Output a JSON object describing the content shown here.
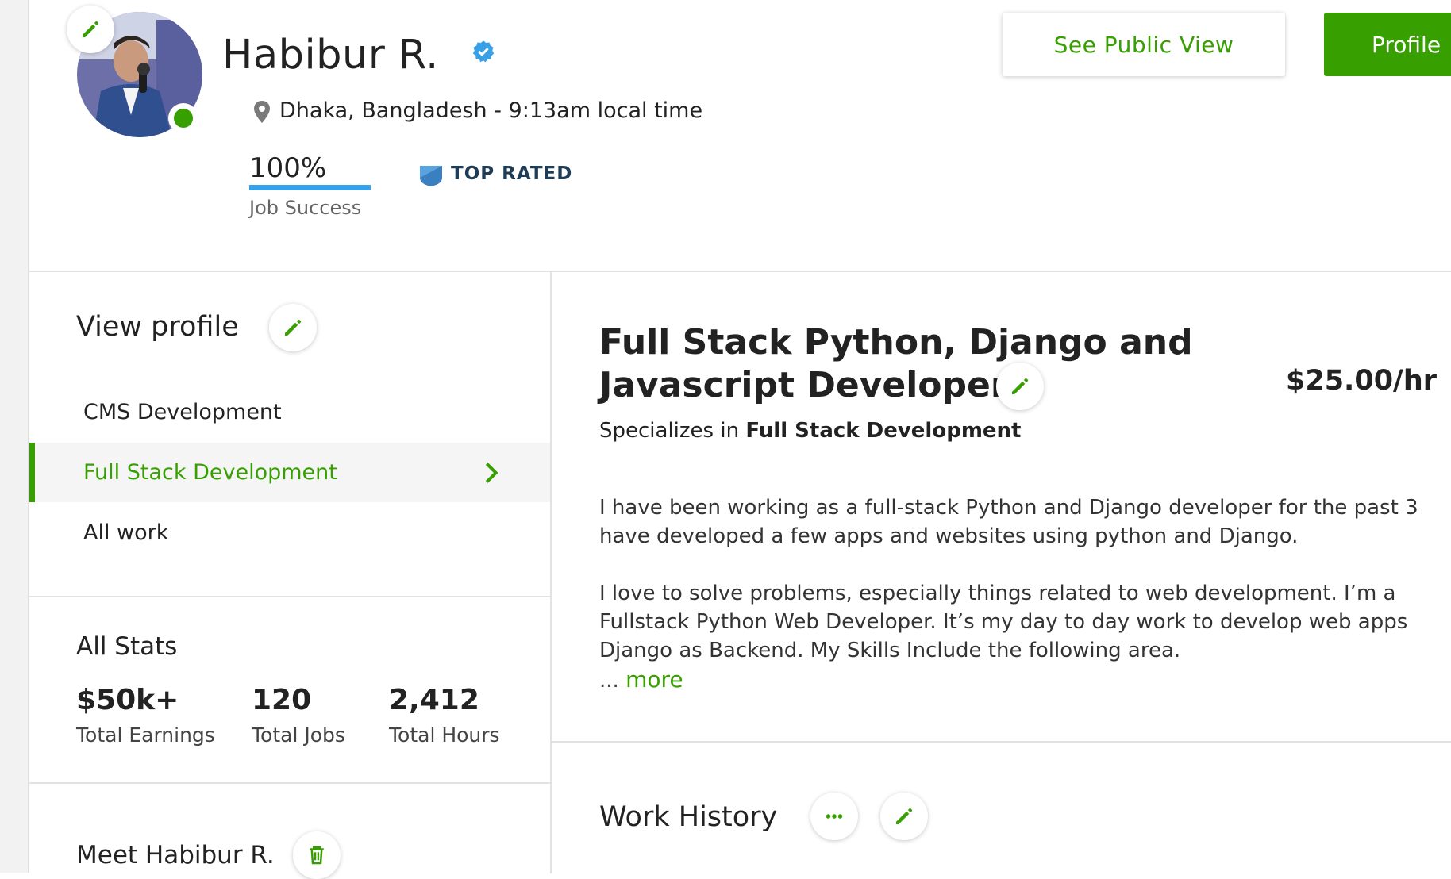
{
  "colors": {
    "green": "#37a000",
    "blue": "#37a0e6",
    "navy": "#1f3d57"
  },
  "profile": {
    "name": "Habibur R.",
    "location": "Dhaka, Bangladesh",
    "local_time": "- 9:13am local time",
    "job_success_value": "100%",
    "job_success_fraction": 1.0,
    "job_success_label": "Job Success",
    "badge": "TOP RATED"
  },
  "header": {
    "public_view_button": "See Public View",
    "profile_button": "Profile"
  },
  "sidebar": {
    "title": "View profile",
    "items": [
      {
        "label": "CMS Development",
        "active": false
      },
      {
        "label": "Full Stack Development",
        "active": true
      },
      {
        "label": "All work",
        "active": false
      }
    ],
    "stats_title": "All Stats",
    "stats": [
      {
        "value": "$50k+",
        "label": "Total Earnings"
      },
      {
        "value": "120",
        "label": "Total Jobs"
      },
      {
        "value": "2,412",
        "label": "Total Hours"
      }
    ],
    "meet_title": "Meet Habibur R."
  },
  "main": {
    "title_line1": "Full Stack Python, Django and",
    "title_line2": "Javascript Developer",
    "rate": "$25.00/hr",
    "specializes_prefix": "Specializes in",
    "specializes_value": "Full Stack Development",
    "description": [
      "I have been working as a full-stack Python and Django developer for the past 3",
      "have developed a few apps and websites using python and Django.",
      "",
      "I love to solve problems, especially things related to web development. I’m a",
      "Fullstack Python Web Developer. It’s my day to day work to develop web apps",
      "Django as Backend. My Skills Include the following area."
    ],
    "ellipsis": "...",
    "more_link": "more",
    "work_history_title": "Work History"
  }
}
